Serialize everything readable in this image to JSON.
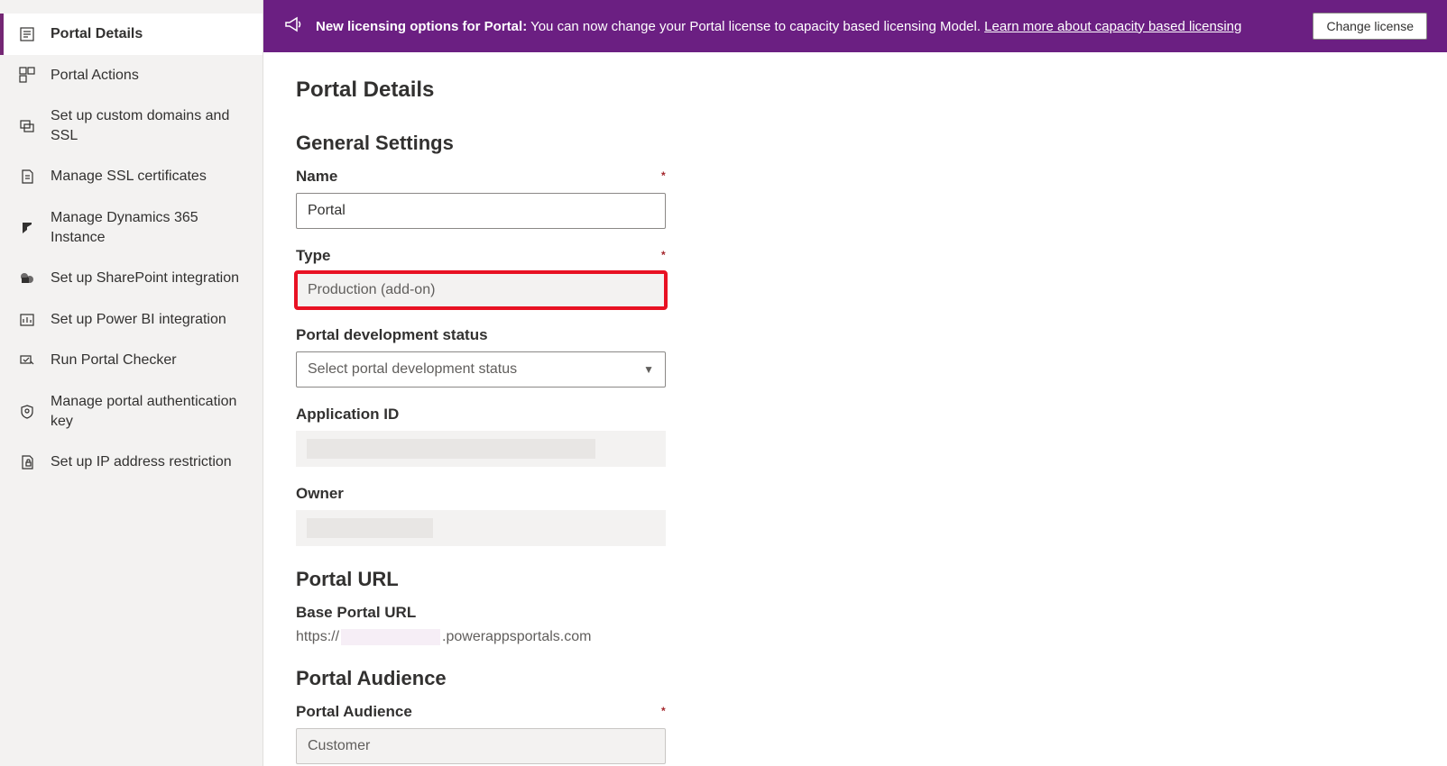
{
  "sidebar": {
    "items": [
      {
        "label": "Portal Details",
        "active": true
      },
      {
        "label": "Portal Actions"
      },
      {
        "label": "Set up custom domains and SSL"
      },
      {
        "label": "Manage SSL certificates"
      },
      {
        "label": "Manage Dynamics 365 Instance"
      },
      {
        "label": "Set up SharePoint integration"
      },
      {
        "label": "Set up Power BI integration"
      },
      {
        "label": "Run Portal Checker"
      },
      {
        "label": "Manage portal authentication key"
      },
      {
        "label": "Set up IP address restriction"
      }
    ]
  },
  "banner": {
    "prefix": "New licensing options for Portal:",
    "body": " You can now change your Portal license to capacity based licensing Model. ",
    "link": "Learn more about capacity based licensing",
    "button": "Change license"
  },
  "page": {
    "title": "Portal Details",
    "sections": {
      "general": {
        "title": "General Settings",
        "name_label": "Name",
        "name_value": "Portal",
        "type_label": "Type",
        "type_value": "Production (add-on)",
        "dev_status_label": "Portal development status",
        "dev_status_placeholder": "Select portal development status",
        "app_id_label": "Application ID",
        "owner_label": "Owner"
      },
      "url": {
        "title": "Portal URL",
        "base_label": "Base Portal URL",
        "base_prefix": "https://",
        "base_suffix": ".powerappsportals.com"
      },
      "audience": {
        "title": "Portal Audience",
        "label": "Portal Audience",
        "value": "Customer"
      }
    }
  }
}
